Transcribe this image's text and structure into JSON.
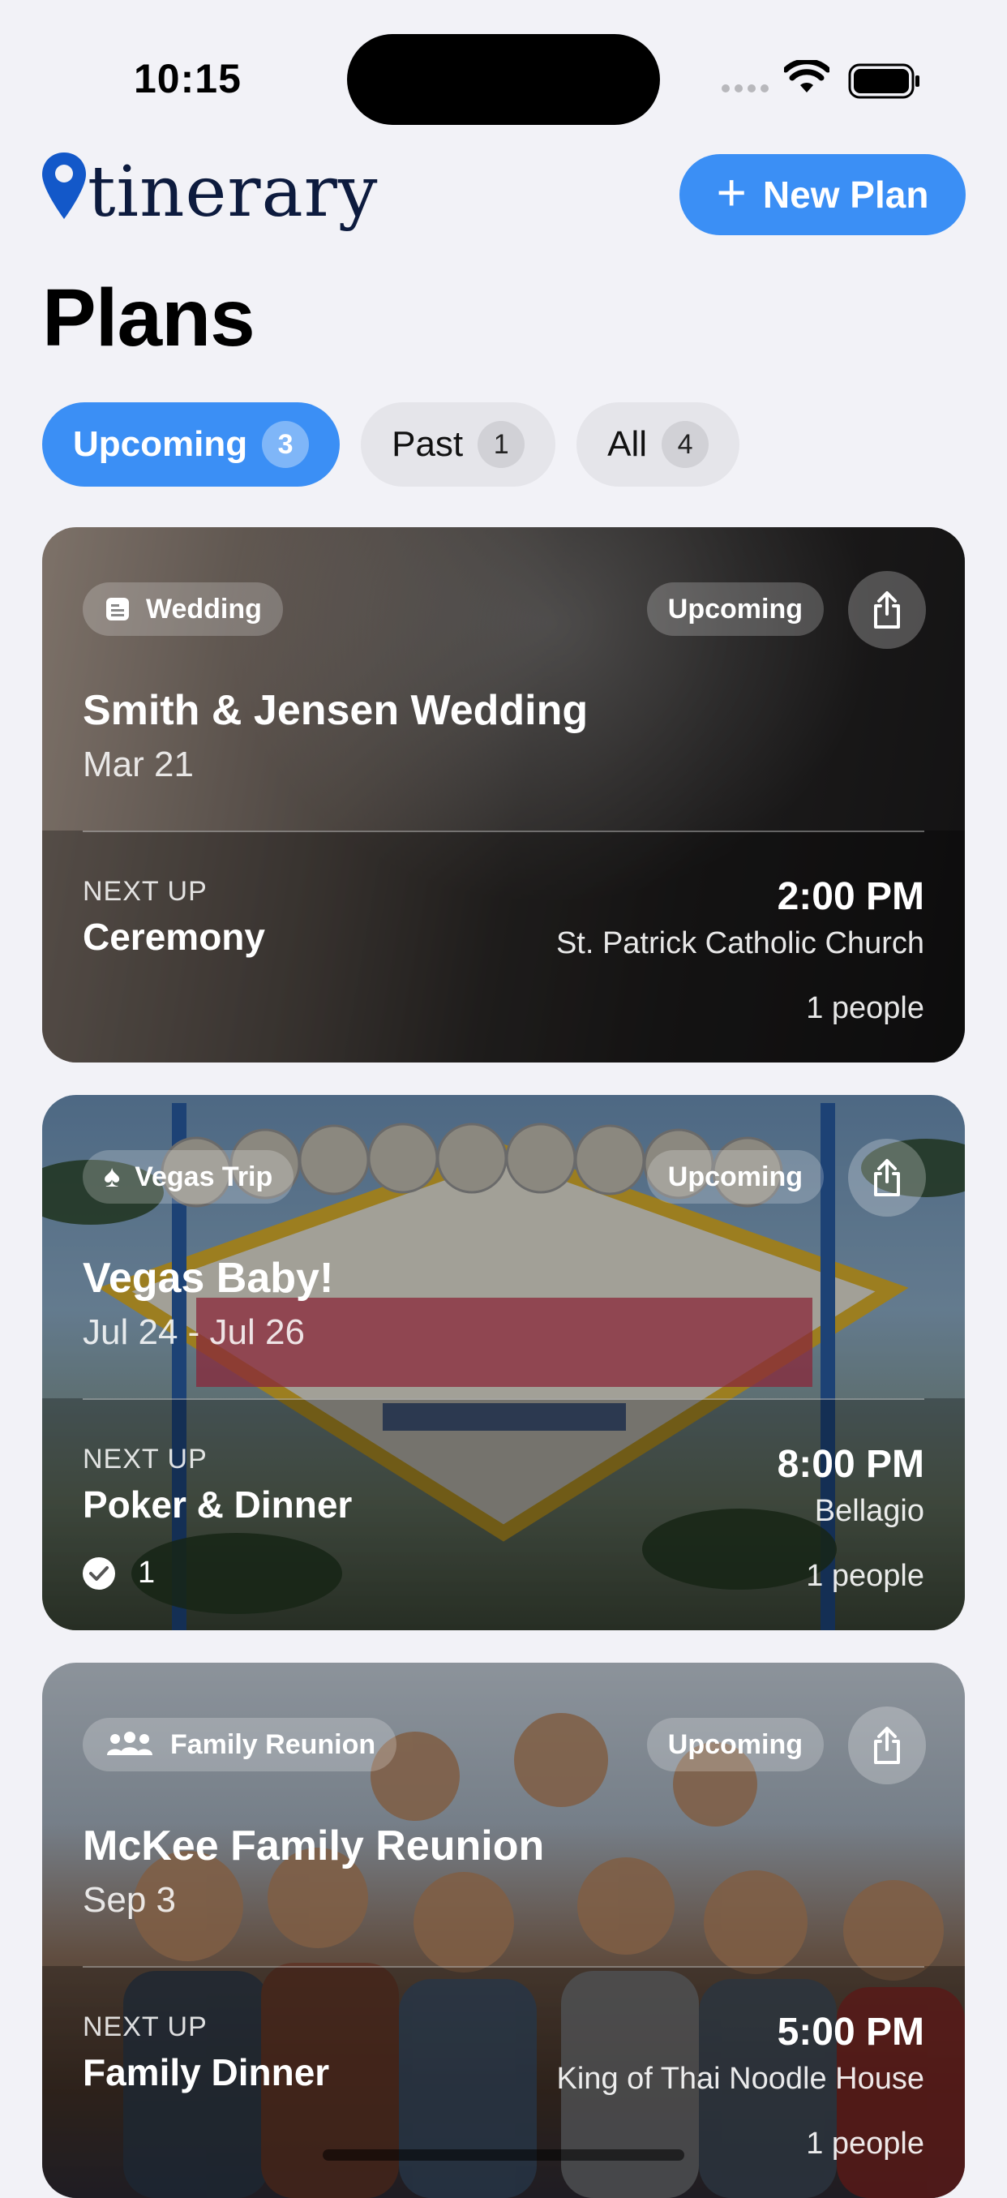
{
  "status_bar": {
    "time": "10:15"
  },
  "header": {
    "logo_text": "tinerary",
    "new_plan_label": "New Plan"
  },
  "page_title": "Plans",
  "tabs": [
    {
      "label": "Upcoming",
      "count": "3",
      "active": true
    },
    {
      "label": "Past",
      "count": "1",
      "active": false
    },
    {
      "label": "All",
      "count": "4",
      "active": false
    }
  ],
  "plans": [
    {
      "category": "Wedding",
      "category_icon": "wedding-card-icon",
      "status": "Upcoming",
      "title": "Smith & Jensen Wedding",
      "date": "Mar 21",
      "next_up_label": "NEXT UP",
      "next_event": "Ceremony",
      "time": "2:00 PM",
      "location": "St. Patrick Catholic Church",
      "people": "1 people"
    },
    {
      "category": "Vegas Trip",
      "category_icon": "spade-icon",
      "status": "Upcoming",
      "title": "Vegas Baby!",
      "date": "Jul 24 - Jul 26",
      "next_up_label": "NEXT UP",
      "next_event": "Poker & Dinner",
      "time": "8:00 PM",
      "location": "Bellagio",
      "people": "1 people",
      "checked_count": "1"
    },
    {
      "category": "Family Reunion",
      "category_icon": "people-group-icon",
      "status": "Upcoming",
      "title": "McKee Family Reunion",
      "date": "Sep 3",
      "next_up_label": "NEXT UP",
      "next_event": "Family Dinner",
      "time": "5:00 PM",
      "location": "King of Thai Noodle House",
      "people": "1 people"
    }
  ],
  "colors": {
    "accent": "#3b8ff5",
    "background": "#f2f2f7",
    "logo_pin": "#1358c9",
    "logo_text": "#0d1b3e"
  }
}
